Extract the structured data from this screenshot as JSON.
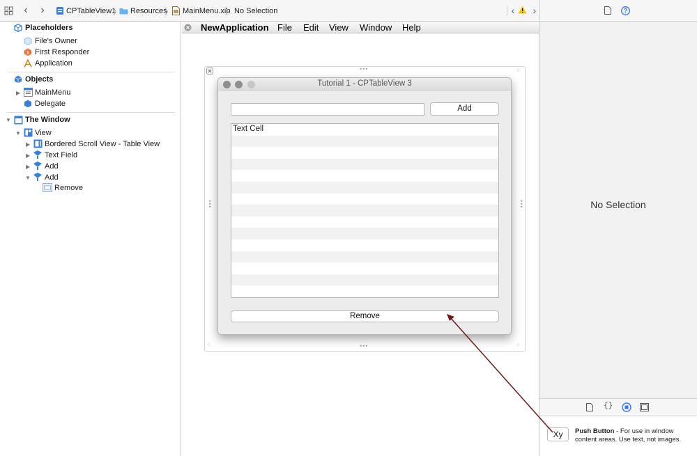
{
  "jumpbar": {
    "crumbs": [
      "CPTableView1",
      "Resources",
      "MainMenu.xib",
      "No Selection"
    ]
  },
  "outline": {
    "placeholders": {
      "title": "Placeholders",
      "items": [
        "File's Owner",
        "First Responder",
        "Application"
      ]
    },
    "objects": {
      "title": "Objects",
      "items": [
        "MainMenu",
        "Delegate"
      ]
    },
    "window": {
      "title": "The Window",
      "items": [
        "View",
        "Bordered Scroll View - Table View",
        "Text Field",
        "Add",
        "Add",
        "Remove"
      ]
    }
  },
  "menubar": {
    "app_name": "NewApplication",
    "items": [
      "File",
      "Edit",
      "View",
      "Window",
      "Help"
    ]
  },
  "window": {
    "title": "Tutorial 1 - CPTableView 3",
    "add_button": "Add",
    "text_cell": "Text Cell",
    "remove_button": "Remove",
    "text_field_value": ""
  },
  "inspector": {
    "no_selection": "No Selection"
  },
  "library": {
    "icon_label": "Xy",
    "item_name": "Push Button",
    "item_desc": " - For use in window content areas. Use text, not images."
  },
  "colors": {
    "accent": "#3478f6",
    "arrow": "#6b1a1a",
    "warning": "#f5c400"
  }
}
